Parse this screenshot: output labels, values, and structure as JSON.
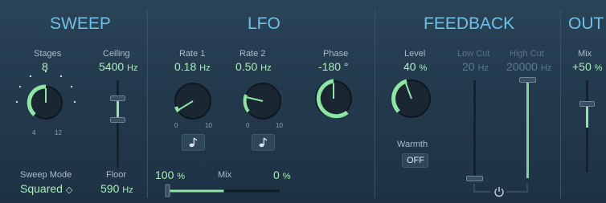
{
  "sweep": {
    "title": "SWEEP",
    "stages_label": "Stages",
    "stages_value": "8",
    "stages_min_tick": "4",
    "stages_max_tick": "12",
    "ceiling_label": "Ceiling",
    "ceiling_value": "5400",
    "ceiling_unit": "Hz",
    "floor_label": "Floor",
    "floor_value": "590",
    "floor_unit": "Hz",
    "mode_label": "Sweep Mode",
    "mode_value": "Squared",
    "mode_arrow": "◇"
  },
  "lfo": {
    "title": "LFO",
    "rate1_label": "Rate 1",
    "rate1_value": "0.18",
    "rate1_unit": "Hz",
    "rate1_min": "0",
    "rate1_max": "10",
    "rate2_label": "Rate 2",
    "rate2_value": "0.50",
    "rate2_unit": "Hz",
    "rate2_min": "0",
    "rate2_max": "10",
    "phase_label": "Phase",
    "phase_value": "-180 °",
    "mix_left_value": "100",
    "mix_left_unit": "%",
    "mix_label": "Mix",
    "mix_right_value": "0",
    "mix_right_unit": "%",
    "mix_fraction": 0.5
  },
  "feedback": {
    "title": "FEEDBACK",
    "level_label": "Level",
    "level_value": "40",
    "level_unit": "%",
    "lowcut_label": "Low Cut",
    "lowcut_value": "20",
    "lowcut_unit": "Hz",
    "highcut_label": "High Cut",
    "highcut_value": "20000",
    "highcut_unit": "Hz",
    "warmth_label": "Warmth",
    "warmth_value": "OFF"
  },
  "out": {
    "title": "OUT",
    "mix_label": "Mix",
    "mix_value": "+50",
    "mix_unit": "%"
  },
  "colors": {
    "accent_green": "#a8f0b6",
    "title_blue": "#6fc0e6",
    "panel_bg": "#233a4d"
  },
  "icons": [
    "sync-note-icon",
    "power-icon",
    "up-down-arrows-icon"
  ]
}
